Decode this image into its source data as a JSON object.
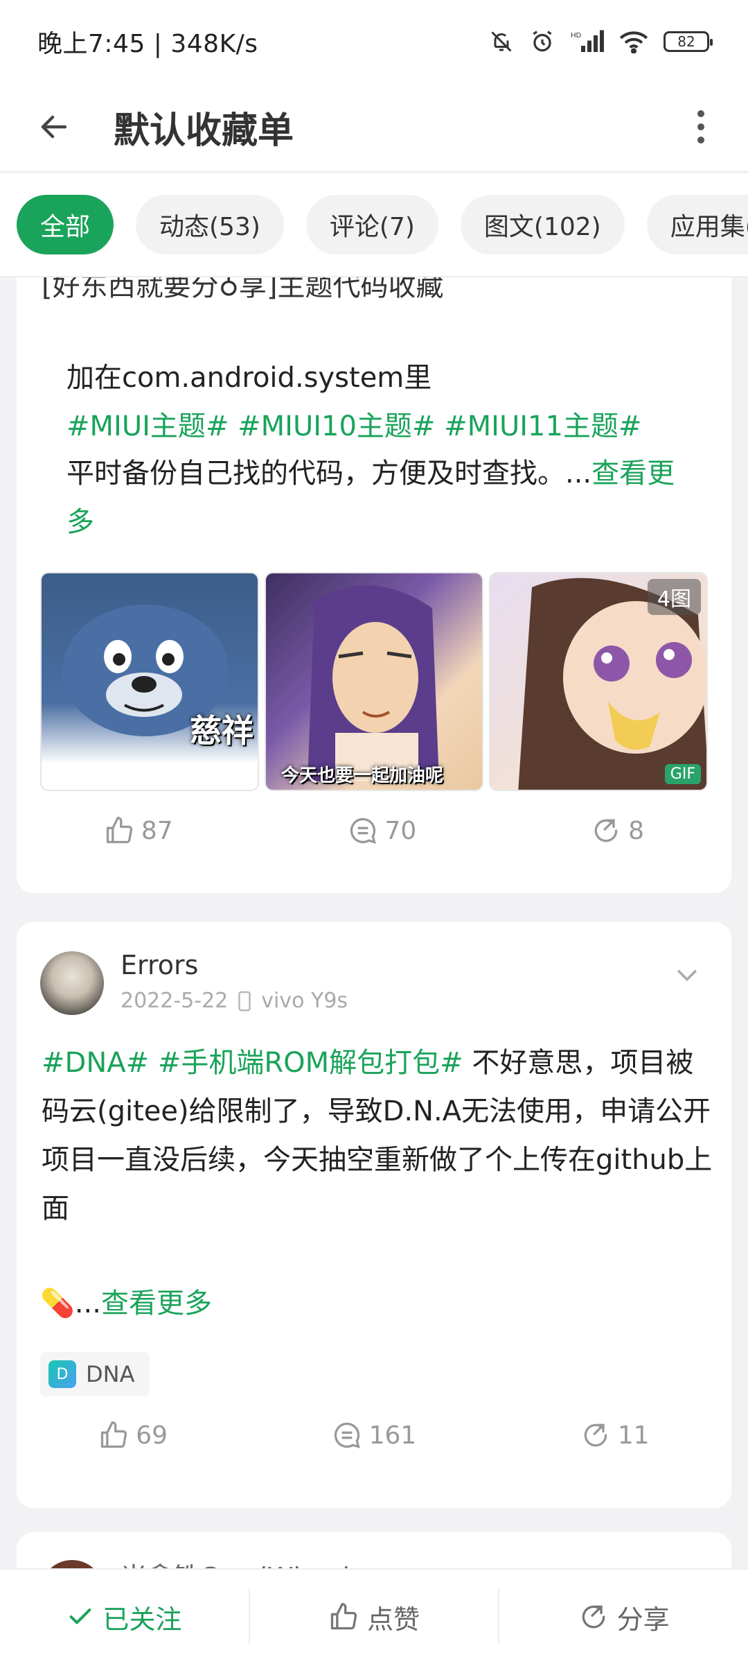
{
  "status_bar": {
    "time_speed": "晚上7:45 | 348K/s",
    "battery": "82"
  },
  "header": {
    "title": "默认收藏单"
  },
  "tabs": [
    {
      "label": "全部",
      "active": true
    },
    {
      "label": "动态(53)",
      "active": false
    },
    {
      "label": "评论(7)",
      "active": false
    },
    {
      "label": "图文(102)",
      "active": false
    },
    {
      "label": "应用集(",
      "active": false
    }
  ],
  "card1": {
    "cut_line": "[好东西就要分♁享]主题代码收藏",
    "line1": "加在com.android.system里",
    "hashtags": "#MIUI主题# #MIUI10主题# #MIUI11主题#",
    "line3_text": "平时备份自己找的代码，方便及时查找。...",
    "see_more": "查看更多",
    "images": [
      {
        "caption": "慈祥"
      },
      {
        "caption": "今天也要一起加油呢"
      },
      {
        "badge": "4图",
        "gif": "GIF"
      }
    ],
    "likes": "87",
    "comments": "70",
    "shares": "8"
  },
  "card2": {
    "author": "Errors",
    "date": "2022-5-22",
    "device": "vivo Y9s",
    "hashtag1": "#DNA#",
    "hashtag2": "#手机端ROM解包打包#",
    "text": "不好意思，项目被码云(gitee)给限制了，导致D.N.A无法使用，申请公开项目一直没后续，今天抽空重新做了个上传在github上面",
    "pill": "💊",
    "ellipsis": "...",
    "see_more": "查看更多",
    "tag_icon_letter": "D",
    "tag": "DNA",
    "likes": "69",
    "comments": "161",
    "shares": "11"
  },
  "card3": {
    "author_partial": "米拿铁CandWheel"
  },
  "bottom_bar": {
    "followed": "已关注",
    "like": "点赞",
    "share": "分享"
  },
  "colors": {
    "accent": "#1aa35a",
    "background": "#f2f2f5",
    "muted": "#999999"
  }
}
